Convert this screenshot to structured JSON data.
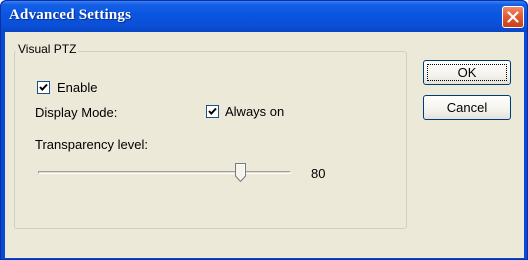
{
  "window": {
    "title": "Advanced Settings",
    "titlebar_color": "#0a55e0",
    "close_icon": "close-icon"
  },
  "group": {
    "label": "Visual PTZ"
  },
  "enable": {
    "label": "Enable",
    "checked": true
  },
  "display_mode": {
    "label": "Display Mode:",
    "always_on_label": "Always on",
    "always_on_checked": true
  },
  "transparency": {
    "label": "Transparency level:",
    "value": "80",
    "slider_fraction": 0.8
  },
  "buttons": {
    "ok_label": "OK",
    "cancel_label": "Cancel"
  }
}
